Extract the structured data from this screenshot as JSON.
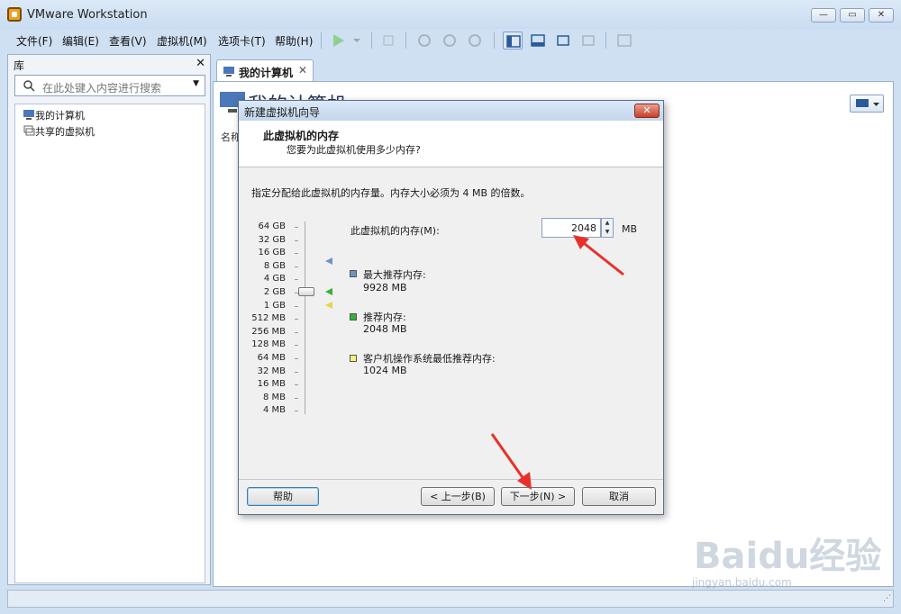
{
  "window": {
    "title": "VMware Workstation"
  },
  "menu": [
    "文件(F)",
    "编辑(E)",
    "查看(V)",
    "虚拟机(M)",
    "选项卡(T)",
    "帮助(H)"
  ],
  "library": {
    "title": "库",
    "search_placeholder": "在此处键入内容进行搜索",
    "items": [
      "我的计算机",
      "共享的虚拟机"
    ]
  },
  "tab": {
    "label": "我的计算机"
  },
  "main": {
    "heading": "我的计算机",
    "column_name": "名称"
  },
  "dialog": {
    "title": "新建虚拟机向导",
    "heading": "此虚拟机的内存",
    "subheading": "您要为此虚拟机使用多少内存?",
    "description": "指定分配给此虚拟机的内存量。内存大小必须为 4 MB 的倍数。",
    "scale_labels": [
      "64 GB",
      "32 GB",
      "16 GB",
      "8 GB",
      "4 GB",
      "2 GB",
      "1 GB",
      "512 MB",
      "256 MB",
      "128 MB",
      "64 MB",
      "32 MB",
      "16 MB",
      "8 MB",
      "4 MB"
    ],
    "memory_label": "此虚拟机的内存(M):",
    "memory_value": "2048",
    "memory_unit": "MB",
    "legend": [
      {
        "label": "最大推荐内存:",
        "value": "9928 MB",
        "color": "#6f93c6"
      },
      {
        "label": "推荐内存:",
        "value": "2048 MB",
        "color": "#34b234"
      },
      {
        "label": "客户机操作系统最低推荐内存:",
        "value": "1024 MB",
        "color": "#f5f07a"
      }
    ],
    "buttons": {
      "help": "帮助",
      "back": "< 上一步(B)",
      "next": "下一步(N) >",
      "cancel": "取消"
    }
  },
  "watermark": {
    "brand": "Baidu经验",
    "url": "jingyan.baidu.com"
  }
}
